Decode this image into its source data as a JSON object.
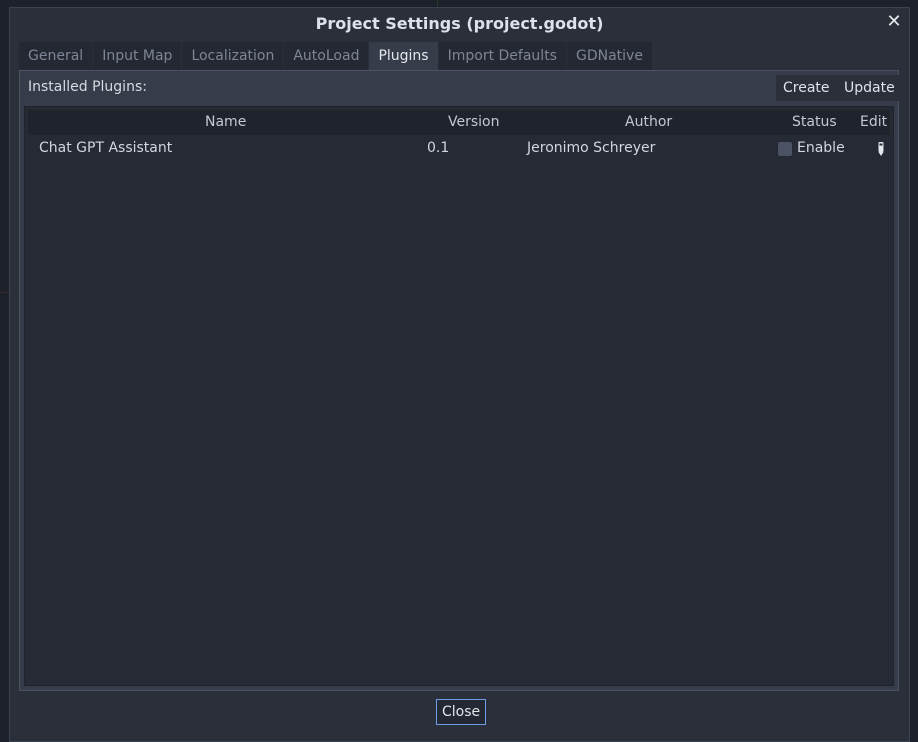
{
  "window": {
    "title": "Project Settings (project.godot)"
  },
  "tabs": [
    {
      "label": "General",
      "active": false
    },
    {
      "label": "Input Map",
      "active": false
    },
    {
      "label": "Localization",
      "active": false
    },
    {
      "label": "AutoLoad",
      "active": false
    },
    {
      "label": "Plugins",
      "active": true
    },
    {
      "label": "Import Defaults",
      "active": false
    },
    {
      "label": "GDNative",
      "active": false
    }
  ],
  "plugins": {
    "installed_label": "Installed Plugins:",
    "create_label": "Create",
    "update_label": "Update",
    "columns": {
      "name": "Name",
      "version": "Version",
      "author": "Author",
      "status": "Status",
      "edit": "Edit"
    },
    "rows": [
      {
        "name": "Chat GPT Assistant",
        "version": "0.1",
        "author": "Jeronimo Schreyer",
        "status_label": "Enable",
        "enabled": false,
        "edit_icon": "edit-icon"
      }
    ]
  },
  "footer": {
    "close_label": "Close"
  },
  "colors": {
    "accent": "#6f9ee8",
    "background": "#2a2f3a",
    "panel": "#363c4a",
    "tree": "#252a34"
  }
}
